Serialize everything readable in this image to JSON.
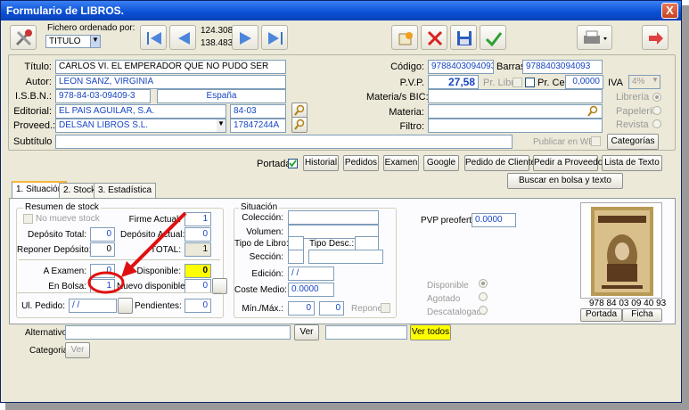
{
  "window": {
    "title": "Formulario de LIBROS.",
    "close_label": "X"
  },
  "toolbar": {
    "sort_label": "Fichero ordenado por:",
    "sort_value": "TITULO",
    "record_current": "124.308",
    "record_total": "138.483"
  },
  "form": {
    "titulo_label": "Título:",
    "titulo": "CARLOS VI. EL EMPERADOR QUE NO PUDO SER",
    "autor_label": "Autor:",
    "autor": "LEON SANZ, VIRGINIA",
    "isbn_label": "I.S.B.N.:",
    "isbn": "978-84-03-09409-3",
    "pais": "España",
    "editorial_label": "Editorial:",
    "editorial": "EL PAIS AGUILAR, S.A.",
    "editorial_code": "84-03",
    "proveedor_label": "Proveed.:",
    "proveedor": "DELSAN LIBROS S.L.",
    "proveedor_code": "17847244A",
    "subtitulo_label": "Subtítulo",
    "codigo_label": "Código:",
    "codigo": "9788403094093",
    "barras_label": "Barras:",
    "barras": "9788403094093",
    "pvp_label": "P.V.P.",
    "pvp": "27,58",
    "precio_libre_label": "Pr. Libre",
    "precio_cesion_label": "Pr. Cesión",
    "precio_cesion": "0,0000",
    "iva_label": "IVA",
    "iva": "4%",
    "materias_bic_label": "Materia/s BIC:",
    "materia_label": "Materia:",
    "filtro_label": "Filtro:",
    "libreria_label": "Librería",
    "papeleria_label": "Papelería",
    "revista_label": "Revista",
    "publicar_web_label": "Publicar en WEB",
    "categorias_label": "Categorías"
  },
  "actions": {
    "portadas_label": "Portadas",
    "historial": "Historial",
    "pedidos": "Pedidos",
    "examen": "Examen",
    "google": "Google",
    "pedido_cliente": "Pedido de Cliente",
    "pedir_proveedor": "Pedir a Proveedor",
    "lista_texto": "Lista de Texto",
    "buscar_bolsa": "Buscar en bolsa y texto"
  },
  "tabs": [
    {
      "label": "1. Situación"
    },
    {
      "label": "2. Stock"
    },
    {
      "label": "3. Estadística"
    }
  ],
  "stock": {
    "group_title": "Resumen de stock",
    "no_mueve_label": "No mueve stock",
    "deposito_total_label": "Depósito Total:",
    "deposito_total": "0",
    "reponer_deposito_label": "Reponer Depósito:",
    "reponer_deposito": "0",
    "firme_actual_label": "Firme Actual:",
    "firme_actual": "1",
    "deposito_actual_label": "Depósito Actual:",
    "deposito_actual": "0",
    "total_label": "TOTAL:",
    "total": "1",
    "a_examen_label": "A Examen:",
    "a_examen": "0",
    "en_bolsa_label": "En Bolsa:",
    "en_bolsa": "1",
    "disponible_label": "Disponible:",
    "disponible": "0",
    "nuevo_disponible_label": "Nuevo disponible:",
    "nuevo_disponible": "0",
    "ul_pedido_label": "Ul. Pedido:",
    "ul_pedido": "/ /",
    "pendientes_label": "Pendientes:",
    "pendientes": "0"
  },
  "situacion": {
    "group_title": "Situación",
    "coleccion_label": "Colección:",
    "volumen_label": "Volumen:",
    "tipo_libro_label": "Tipo de Libro:",
    "tipo_desc_label": "Tipo Desc.:",
    "seccion_label": "Sección:",
    "edicion_label": "Edición:",
    "edicion": "/ /",
    "coste_medio_label": "Coste Medio:",
    "coste_medio": "0.0000",
    "min_max_label": "Mín./Máx.:",
    "min": "0",
    "max": "0",
    "reponer_label": "Reponer"
  },
  "preoferta": {
    "label": "PVP preoferta:",
    "value": "0.0000"
  },
  "estado": {
    "disponible": "Disponible",
    "agotado": "Agotado",
    "descatalogado": "Descatalogado"
  },
  "cover": {
    "barcode_text": "978 84 03 09 40 93",
    "portada_btn": "Portada",
    "ficha_btn": "Ficha",
    "colors": {
      "frame": "#b89a55",
      "inner": "#d9c08a",
      "dark": "#5c3a1e"
    }
  },
  "bottom": {
    "alternativo_label": "Alternativo:",
    "ver_label": "Ver",
    "ver_todos_label": "Ver todos",
    "categoria_label": "Categoria:",
    "ver2_label": "Ver"
  },
  "annotation": {
    "color": "#e01010"
  }
}
